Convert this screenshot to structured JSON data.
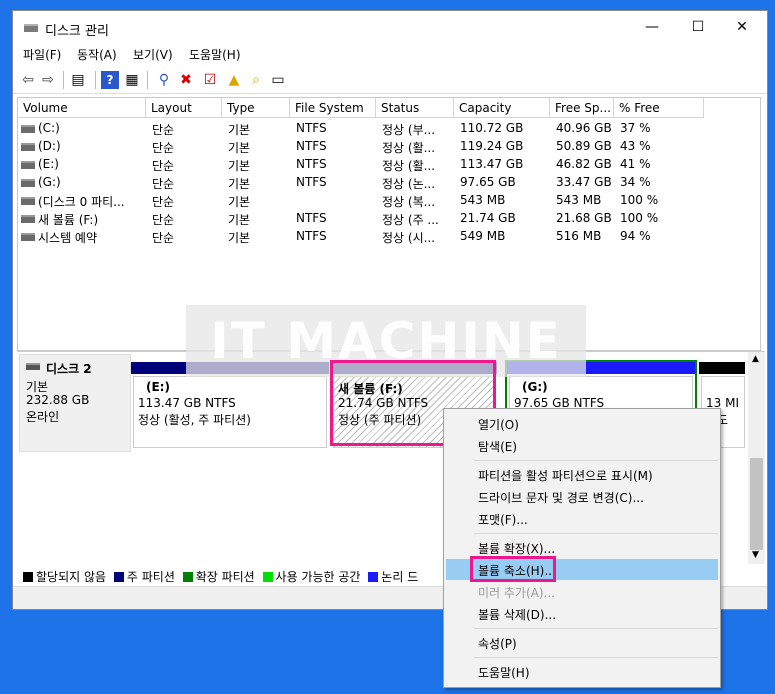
{
  "window": {
    "title": "디스크 관리",
    "controls": {
      "minimize": "—",
      "maximize": "☐",
      "close": "✕"
    }
  },
  "menu": [
    "파일(F)",
    "동작(A)",
    "보기(V)",
    "도움말(H)"
  ],
  "toolbar_icons": [
    "back-icon",
    "forward-icon",
    "console-tree-icon",
    "help-icon",
    "list-icon",
    "connect-icon",
    "delete-icon",
    "check-icon",
    "up-icon",
    "search-icon",
    "properties-icon"
  ],
  "columns": [
    "Volume",
    "Layout",
    "Type",
    "File System",
    "Status",
    "Capacity",
    "Free Sp...",
    "% Free"
  ],
  "volumes": [
    {
      "volume": "(C:)",
      "layout": "단순",
      "type": "기본",
      "fs": "NTFS",
      "status": "정상 (부...",
      "capacity": "110.72 GB",
      "free": "40.96 GB",
      "pct": "37 %"
    },
    {
      "volume": "(D:)",
      "layout": "단순",
      "type": "기본",
      "fs": "NTFS",
      "status": "정상 (활...",
      "capacity": "119.24 GB",
      "free": "50.89 GB",
      "pct": "43 %"
    },
    {
      "volume": "(E:)",
      "layout": "단순",
      "type": "기본",
      "fs": "NTFS",
      "status": "정상 (활...",
      "capacity": "113.47 GB",
      "free": "46.82 GB",
      "pct": "41 %"
    },
    {
      "volume": "(G:)",
      "layout": "단순",
      "type": "기본",
      "fs": "NTFS",
      "status": "정상 (논...",
      "capacity": "97.65 GB",
      "free": "33.47 GB",
      "pct": "34 %"
    },
    {
      "volume": "(디스크 0 파티...",
      "layout": "단순",
      "type": "기본",
      "fs": "",
      "status": "정상 (복...",
      "capacity": "543 MB",
      "free": "543 MB",
      "pct": "100 %"
    },
    {
      "volume": "새 볼륨 (F:)",
      "layout": "단순",
      "type": "기본",
      "fs": "NTFS",
      "status": "정상 (주 ...",
      "capacity": "21.74 GB",
      "free": "21.68 GB",
      "pct": "100 %"
    },
    {
      "volume": "시스템 예약",
      "layout": "단순",
      "type": "기본",
      "fs": "NTFS",
      "status": "정상 (시...",
      "capacity": "549 MB",
      "free": "516 MB",
      "pct": "94 %"
    }
  ],
  "watermark": "IT MACHINE",
  "disk": {
    "name": "디스크 2",
    "type": "기본",
    "size": "232.88 GB",
    "state": "온라인",
    "partitions": [
      {
        "label": "(E:)",
        "size": "113.47 GB NTFS",
        "status": "정상 (활성, 주 파티션)",
        "bar_color": "#00007a"
      },
      {
        "label": "새 볼륨  (F:)",
        "size": "21.74 GB NTFS",
        "status": "정상 (주 파티션)",
        "bar_color": "#00007a"
      },
      {
        "label": "(G:)",
        "size": "97.65 GB NTFS",
        "status": "",
        "bar_color": "#1a1aff"
      },
      {
        "label": "",
        "size": "13 MI",
        "status": "담도",
        "bar_color": "#000000"
      }
    ]
  },
  "legend": [
    {
      "label": "할당되지 않음",
      "color": "#000000"
    },
    {
      "label": "주 파티션",
      "color": "#00007a"
    },
    {
      "label": "확장 파티션",
      "color": "#008000"
    },
    {
      "label": "사용 가능한 공간",
      "color": "#00e000"
    },
    {
      "label": "논리 드",
      "color": "#1a1aff"
    }
  ],
  "context_menu": {
    "items": [
      {
        "label": "열기(O)",
        "enabled": true
      },
      {
        "label": "탐색(E)",
        "enabled": true
      },
      {
        "label": "파티션을 활성 파티션으로 표시(M)",
        "enabled": true
      },
      {
        "label": "드라이브 문자 및 경로 변경(C)...",
        "enabled": true
      },
      {
        "label": "포맷(F)...",
        "enabled": true
      },
      {
        "label": "볼륨 확장(X)...",
        "enabled": true
      },
      {
        "label": "볼륨 축소(H)...",
        "enabled": true,
        "selected": true
      },
      {
        "label": "미러 추가(A)...",
        "enabled": false
      },
      {
        "label": "볼륨 삭제(D)...",
        "enabled": true
      },
      {
        "label": "속성(P)",
        "enabled": true
      },
      {
        "label": "도움말(H)",
        "enabled": true
      }
    ]
  },
  "colors": {
    "frame": "#1e73e8",
    "highlight": "#ea1a8c",
    "selection": "#99ccf3"
  }
}
